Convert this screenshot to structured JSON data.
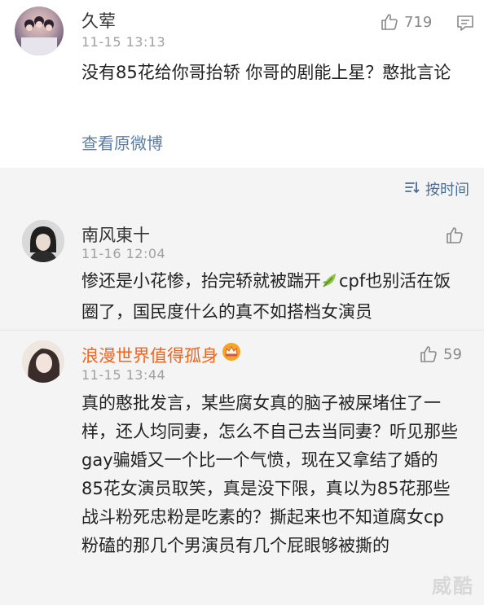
{
  "post": {
    "author": "久荤",
    "time": "11-15 13:13",
    "likes": "719",
    "text": "没有85花给你哥抬轿 你哥的剧能上星？憨批言论",
    "link": "查看原微博"
  },
  "sort_label": "按时间",
  "comments": [
    {
      "author": "南风東十",
      "time": "11-16 12:04",
      "likes": "",
      "text_before": "惨还是小花惨，抬完轿就被踹开",
      "text_after": "cpf也别活在饭圈了，国民度什么的真不如搭档女演员"
    },
    {
      "author": "浪漫世界值得孤身",
      "time": "11-15 13:44",
      "likes": "59",
      "text": "真的憨批发言，某些腐女真的脑子被屎堵住了一样，还人均同妻，怎么不自己去当同妻？听见那些gay骗婚又一个比一个气愤，现在又拿结了婚的85花女演员取笑，真是没下限，真以为85花那些战斗粉死忠粉是吃素的？撕起来也不知道腐女cp粉磕的那几个男演员有几个屁眼够被撕的"
    }
  ],
  "watermark": "威酷",
  "colors": {
    "link": "#5b7da5",
    "orange_name": "#f0641e",
    "gray_bg": "#f4f4f4"
  },
  "icons": [
    "thumbs-up-icon",
    "message-icon",
    "sort-icon",
    "leaf-icon",
    "crown-icon"
  ]
}
